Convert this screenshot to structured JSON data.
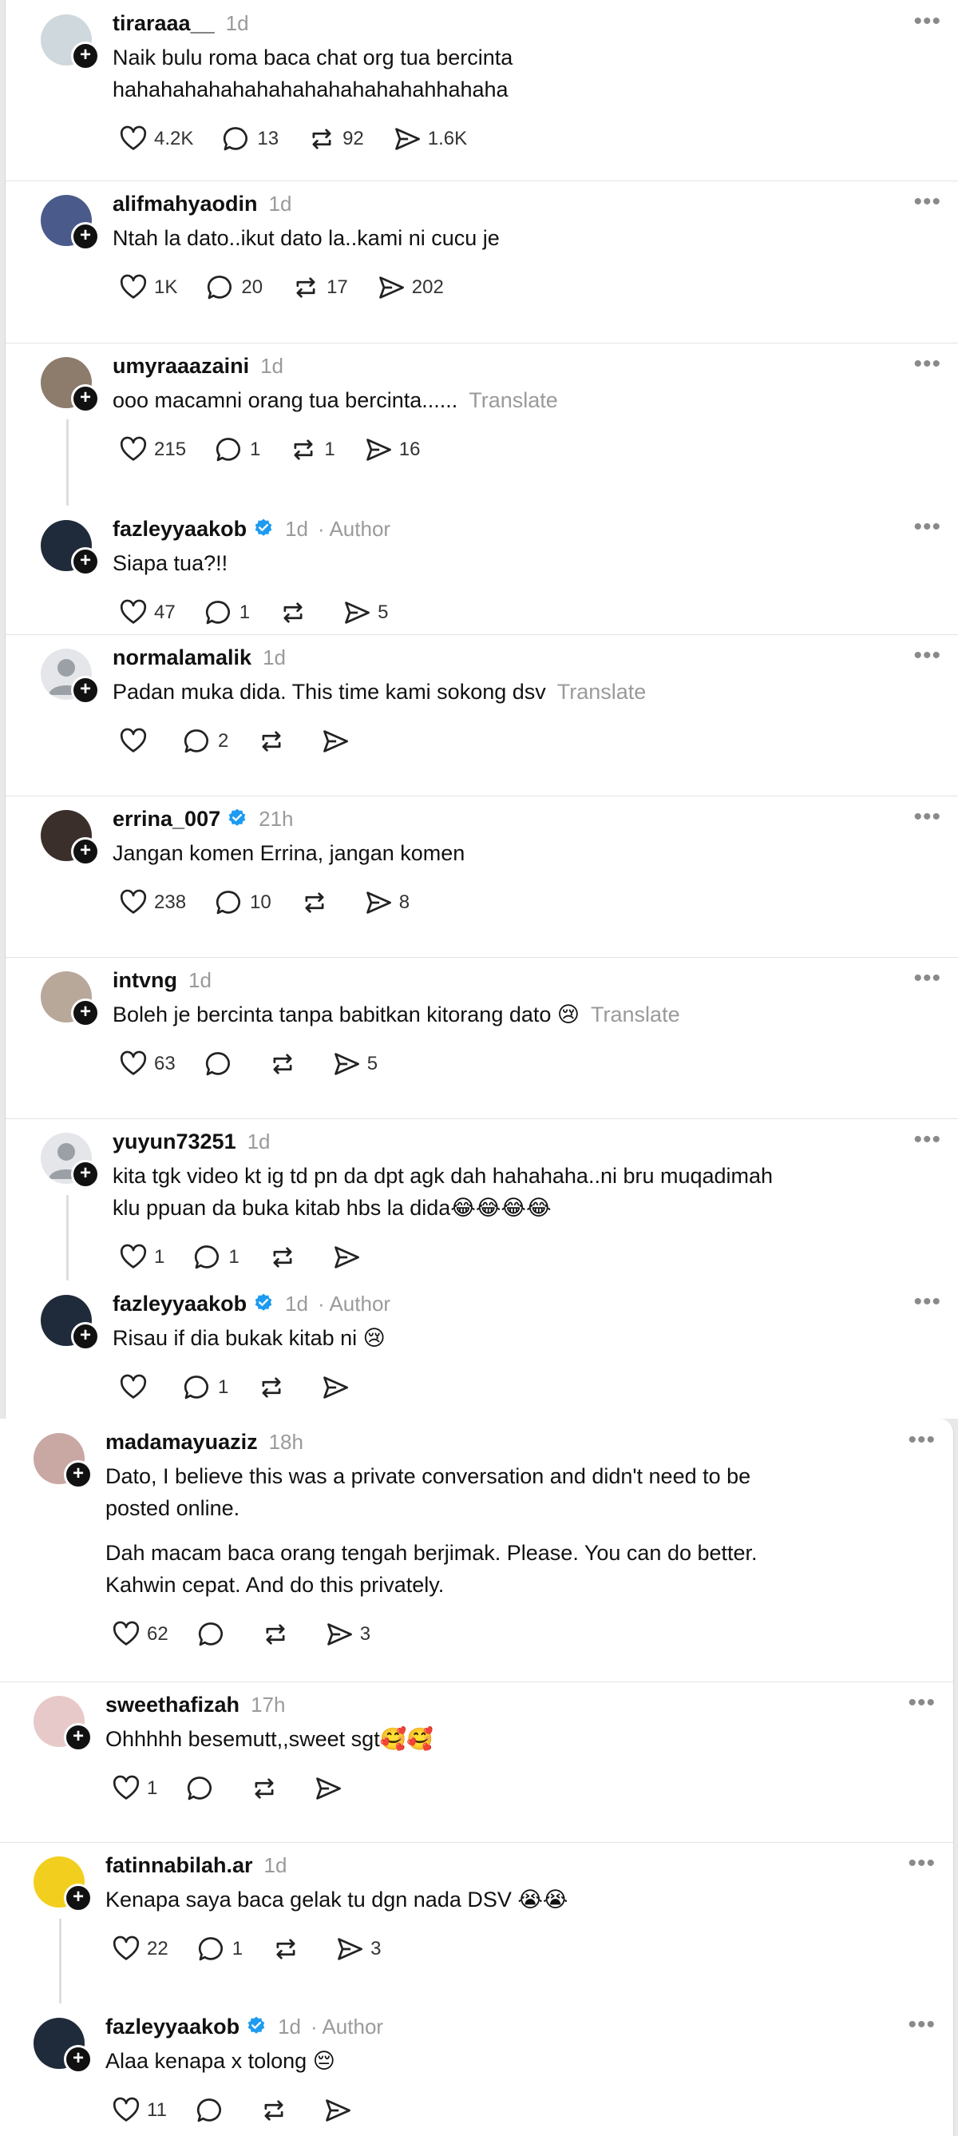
{
  "ui": {
    "more_label": "•••",
    "translate_label": "Translate",
    "author_label": "Author",
    "plus": "+"
  },
  "panel_a": [
    {
      "user": "tiraraaa__",
      "time": "1d",
      "text": "Naik bulu roma baca chat org tua bercinta\nhahahahahahahahahahahahahahhahaha",
      "likes": "4.2K",
      "replies": "13",
      "reposts": "92",
      "shares": "1.6K",
      "avatar_color": "#cfd8dc"
    },
    {
      "user": "alifmahyaodin",
      "time": "1d",
      "text": "Ntah la dato..ikut dato la..kami ni cucu je",
      "likes": "1K",
      "replies": "20",
      "reposts": "17",
      "shares": "202",
      "avatar_color": "#4a5a8a"
    },
    {
      "user": "umyraaazaini",
      "time": "1d",
      "text": "ooo macamni orang tua bercinta......",
      "likes": "215",
      "replies": "1",
      "reposts": "1",
      "shares": "16",
      "avatar_color": "#8d7b6c"
    },
    {
      "user": "fazleyyaakob",
      "time": "1d",
      "text": "Siapa tua?!!",
      "likes": "47",
      "replies": "1",
      "reposts": "",
      "shares": "5",
      "avatar_color": "#1f2b3a"
    },
    {
      "user": "normalamalik",
      "time": "1d",
      "text": "Padan muka dida. This time kami sokong dsv",
      "likes": "",
      "replies": "2",
      "reposts": "",
      "shares": "",
      "avatar_color": "#e4e6ea"
    },
    {
      "user": "errina_007",
      "time": "21h",
      "text": "Jangan komen Errina, jangan komen",
      "likes": "238",
      "replies": "10",
      "reposts": "",
      "shares": "8",
      "avatar_color": "#3a2f2a"
    },
    {
      "user": "intvng",
      "time": "1d",
      "text": "Boleh je bercinta tanpa babitkan kitorang dato 😢",
      "likes": "63",
      "replies": "",
      "reposts": "",
      "shares": "5",
      "avatar_color": "#b8a89a"
    },
    {
      "user": "yuyun73251",
      "time": "1d",
      "text": "kita tgk video kt ig td pn da dpt agk dah hahahaha..ni bru muqadimah\nklu ppuan da buka kitab hbs la dida😂😂😂😂",
      "likes": "1",
      "replies": "1",
      "reposts": "",
      "shares": "",
      "avatar_color": "#e4e6ea"
    },
    {
      "user": "fazleyyaakob",
      "time": "1d",
      "text": "Risau if dia bukak kitab ni 😢",
      "likes": "",
      "replies": "1",
      "reposts": "",
      "shares": "",
      "avatar_color": "#1f2b3a"
    }
  ],
  "panel_b": [
    {
      "user": "madamayuaziz",
      "time": "18h",
      "text": "Dato, I believe this was a private conversation and didn't need to be\nposted online.",
      "text2": "Dah macam baca orang tengah berjimak. Please. You can do better.\nKahwin cepat. And do this privately.",
      "likes": "62",
      "replies": "",
      "reposts": "",
      "shares": "3",
      "avatar_color": "#c9a7a3"
    },
    {
      "user": "sweethafizah",
      "time": "17h",
      "text": "Ohhhhh besemutt,,sweet sgt🥰🥰",
      "likes": "1",
      "replies": "",
      "reposts": "",
      "shares": "",
      "avatar_color": "#e8c9c9"
    },
    {
      "user": "fatinnabilah.ar",
      "time": "1d",
      "text": "Kenapa saya baca gelak tu dgn nada DSV 😭😭",
      "likes": "22",
      "replies": "1",
      "reposts": "",
      "shares": "3",
      "avatar_color": "#f2cf1e"
    },
    {
      "user": "fazleyyaakob",
      "time": "1d",
      "text": "Alaa kenapa x tolong 😔",
      "likes": "11",
      "replies": "",
      "reposts": "",
      "shares": "",
      "avatar_color": "#1f2b3a"
    }
  ]
}
